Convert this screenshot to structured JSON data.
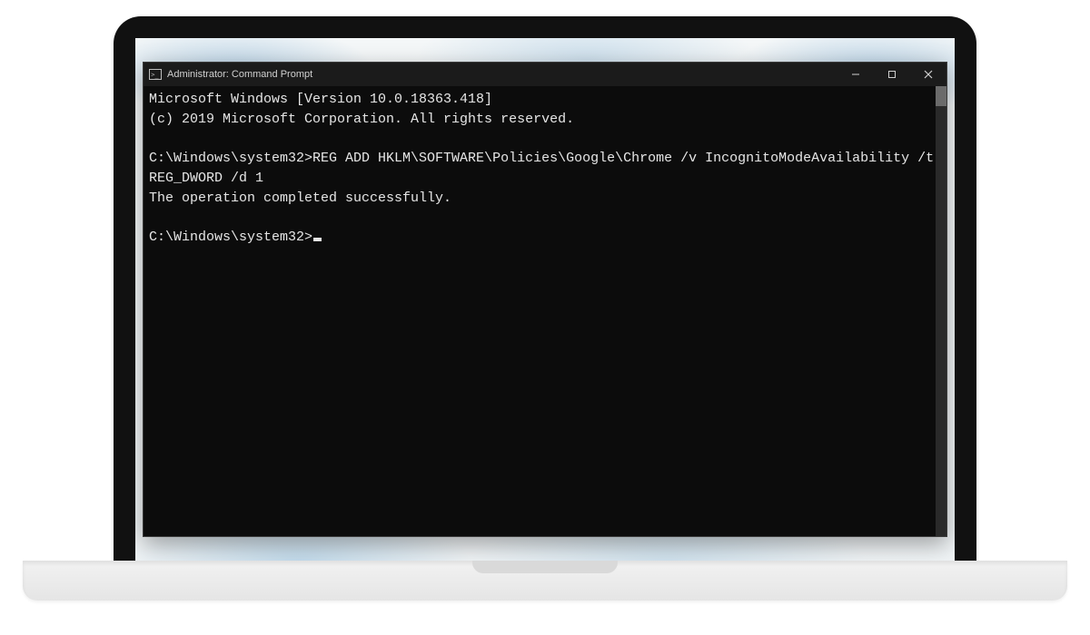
{
  "window": {
    "title": "Administrator: Command Prompt"
  },
  "terminal": {
    "version_line": "Microsoft Windows [Version 10.0.18363.418]",
    "copyright_line": "(c) 2019 Microsoft Corporation. All rights reserved.",
    "prompt1": "C:\\Windows\\system32>",
    "command": "REG ADD HKLM\\SOFTWARE\\Policies\\Google\\Chrome /v IncognitoModeAvailability /t REG_DWORD /d 1",
    "result": "The operation completed successfully.",
    "prompt2": "C:\\Windows\\system32>"
  }
}
